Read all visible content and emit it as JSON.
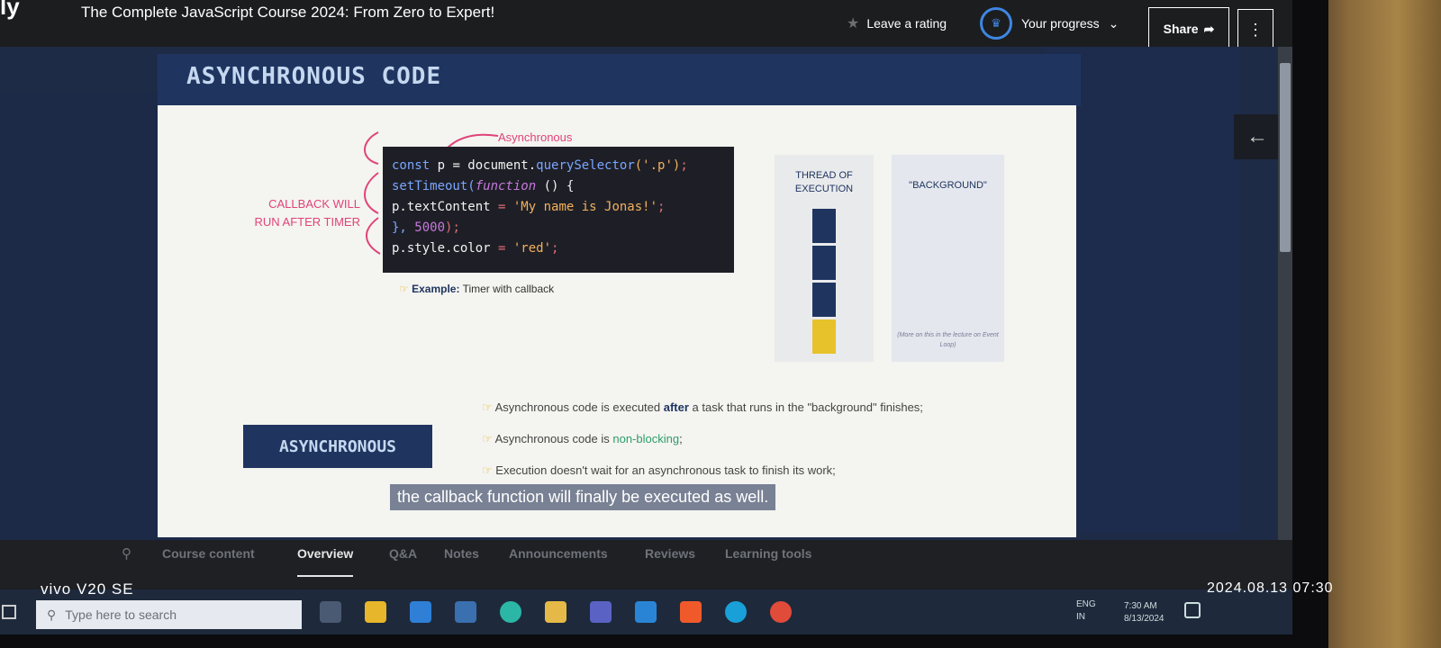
{
  "header": {
    "logo": "ly",
    "course_title": "The Complete JavaScript Course 2024: From Zero to Expert!",
    "leave_rating": "Leave a rating",
    "progress_label": "Your progress",
    "share_label": "Share",
    "more_label": "⋮"
  },
  "slide": {
    "heading": "ASYNCHRONOUS CODE",
    "async_annotation": "Asynchronous",
    "callback_note_line1": "CALLBACK WILL",
    "callback_note_line2": "RUN AFTER TIMER",
    "code": {
      "l1_kw": "const",
      "l1_rest": " p = document.",
      "l1_fn": "querySelector",
      "l1_str": "('.p')",
      "l1_end": ";",
      "l2_fn": "setTimeout(",
      "l2_kw": "function",
      "l2_end": " () {",
      "l3_a": "  p.",
      "l3_b": "textContent",
      "l3_c": " = ",
      "l3_str": "'My name is Jonas!'",
      "l3_end": ";",
      "l4_a": "}, ",
      "l4_num": "5000",
      "l4_end": ");",
      "l5_a": "p.style.color",
      "l5_c": " = ",
      "l5_str": "'red'",
      "l5_end": ";"
    },
    "example_bold": "Example:",
    "example_text": " Timer with callback",
    "thread_title_1": "THREAD OF",
    "thread_title_2": "EXECUTION",
    "background_title": "\"BACKGROUND\"",
    "background_note": "(More on this in the lecture on Event Loop)",
    "bullet1_a": "Asynchronous code is executed ",
    "bullet1_b": "after",
    "bullet1_c": " a task that runs in the \"background\" finishes;",
    "bullet2_a": "Asynchronous code is ",
    "bullet2_b": "non-blocking",
    "bullet2_c": ";",
    "bullet3": "Execution doesn't wait for an asynchronous task to finish its work;",
    "async_box": "ASYNCHRONOUS",
    "caption": "the callback function will finally be executed as well."
  },
  "tabs": [
    "Course content",
    "Overview",
    "Q&A",
    "Notes",
    "Announcements",
    "Reviews",
    "Learning tools"
  ],
  "active_tab": "Overview",
  "taskbar": {
    "search_placeholder": "Type here to search",
    "lang_1": "ENG",
    "lang_2": "IN",
    "time": "7:30 AM",
    "date": "8/13/2024"
  },
  "watermark": {
    "device": "vivo V20 SE",
    "timestamp": "2024.08.13 07:30"
  },
  "icons": {
    "star": "star-icon",
    "back": "arrow-left-icon",
    "search": "search-icon"
  },
  "colors": {
    "brand_blue": "#1f3560",
    "accent_pink": "#e0437a",
    "progress_ring": "#3e86e3"
  }
}
